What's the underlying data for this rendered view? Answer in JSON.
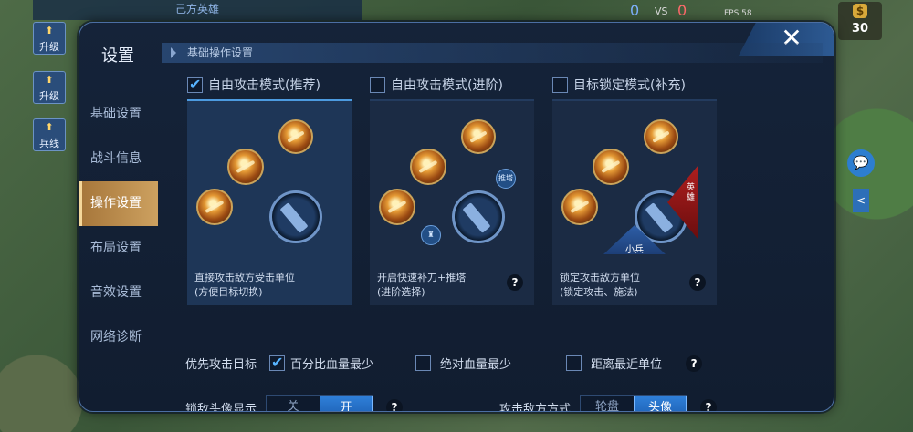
{
  "hud": {
    "team_label": "己方英雄",
    "upgrade1": "升级",
    "upgrade2": "升级",
    "minion_btn": "兵线",
    "score_ally": "0",
    "vs": "VS",
    "score_enemy": "0",
    "fps": "FPS 58",
    "coins": "30"
  },
  "panel": {
    "title": "设置",
    "close_icon": "close-icon",
    "sidebar": [
      {
        "label": "基础设置",
        "active": false
      },
      {
        "label": "战斗信息",
        "active": false
      },
      {
        "label": "操作设置",
        "active": true
      },
      {
        "label": "布局设置",
        "active": false
      },
      {
        "label": "音效设置",
        "active": false
      },
      {
        "label": "网络诊断",
        "active": false
      }
    ],
    "section_title": "基础操作设置",
    "modes": [
      {
        "label": "自由攻击模式(推荐)",
        "checked": true,
        "desc_line1": "直接攻击敌方受击单位",
        "desc_line2": "(方便目标切换)"
      },
      {
        "label": "自由攻击模式(进阶)",
        "checked": false,
        "desc_line1": "开启快速补刀+推塔",
        "desc_line2": "(进阶选择)",
        "icon_tower": "推塔",
        "help": "?"
      },
      {
        "label": "目标锁定模式(补充)",
        "checked": false,
        "desc_line1": "锁定攻击敌方单位",
        "desc_line2": "(锁定攻击、施法)",
        "hero_tag": "英雄",
        "minion_tag": "小兵",
        "help": "?"
      }
    ],
    "priority": {
      "label": "优先攻击目标",
      "options": [
        {
          "label": "百分比血量最少",
          "checked": true
        },
        {
          "label": "绝对血量最少",
          "checked": false
        },
        {
          "label": "距离最近单位",
          "checked": false
        }
      ],
      "help": "?"
    },
    "lock_avatar": {
      "label": "锁敌头像显示",
      "off": "关",
      "on": "开",
      "selected": "开",
      "help": "?"
    },
    "attack_method": {
      "label": "攻击敌方方式",
      "wheel": "轮盘",
      "avatar": "头像",
      "selected": "头像",
      "help": "?"
    }
  }
}
